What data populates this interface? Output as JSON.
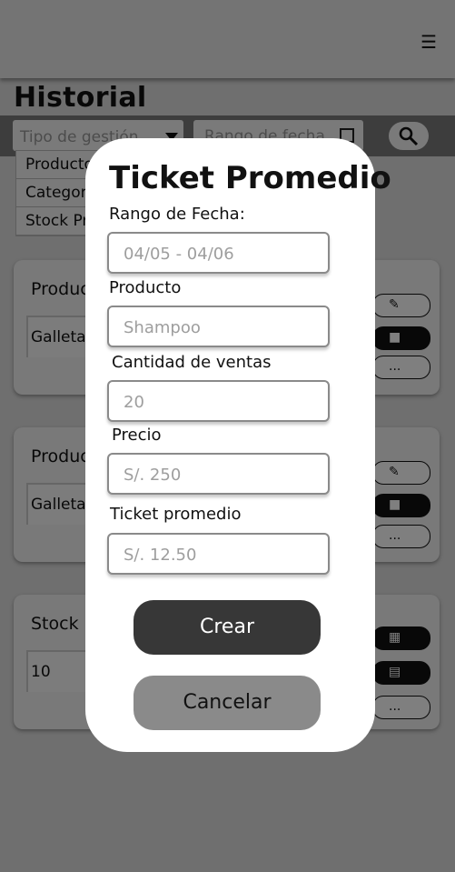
{
  "header": {
    "menu_icon": "hamburger-icon"
  },
  "page": {
    "title": "Historial"
  },
  "filters": {
    "type_placeholder": "Tipo de gestión",
    "date_placeholder": "Rango de fecha",
    "type_options": [
      "Productos",
      "Categorías",
      "Stock Prod"
    ]
  },
  "cards": [
    {
      "title": "Productos",
      "value": "Galletas"
    },
    {
      "title": "Productos",
      "value": "Galletas"
    },
    {
      "title": "Stock",
      "value": "10"
    }
  ],
  "card_actions": {
    "more_label": "..."
  },
  "modal": {
    "title": "Ticket Promedio",
    "fields": [
      {
        "label": "Rango de Fecha:",
        "placeholder": "04/05 - 04/06"
      },
      {
        "label": "Producto",
        "placeholder": "Shampoo"
      },
      {
        "label": "Cantidad de ventas",
        "placeholder": "20"
      },
      {
        "label": "Precio",
        "placeholder": "S/. 250"
      },
      {
        "label": "Ticket promedio",
        "placeholder": "S/. 12.50"
      }
    ],
    "create_label": "Crear",
    "cancel_label": "Cancelar"
  }
}
